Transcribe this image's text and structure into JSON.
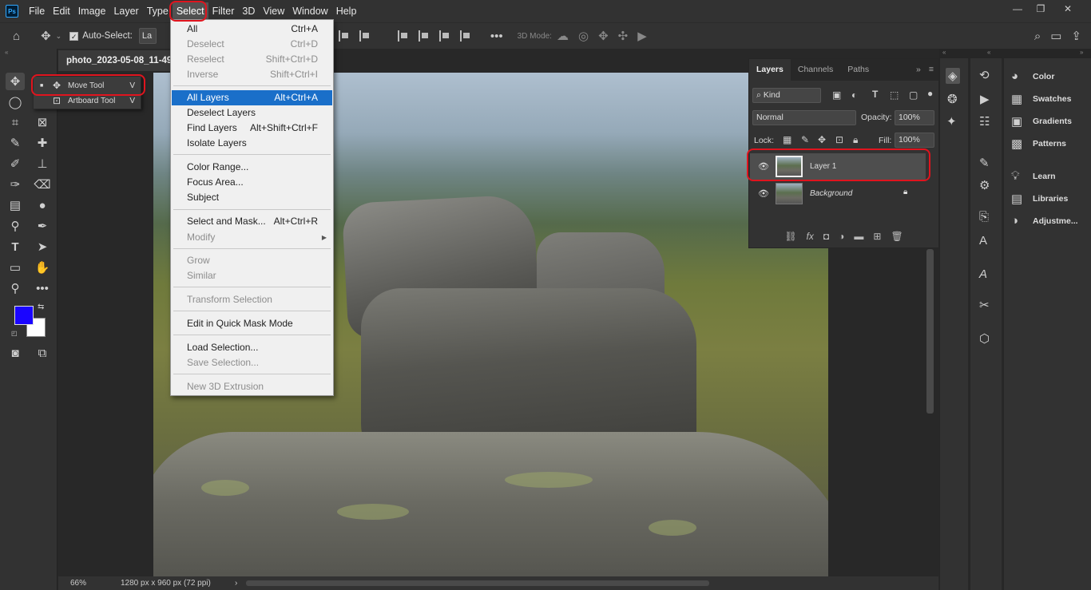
{
  "menubar": {
    "logo": "Ps",
    "items": [
      "File",
      "Edit",
      "Image",
      "Layer",
      "Type",
      "Select",
      "Filter",
      "3D",
      "View",
      "Window",
      "Help"
    ],
    "active_index": 5
  },
  "window_controls": {
    "minimize": "—",
    "restore": "❐",
    "close": "✕"
  },
  "options_bar": {
    "auto_select_label": "Auto-Select:",
    "auto_select_value": "La",
    "more": "•••",
    "mode_3d_label": "3D Mode:"
  },
  "document": {
    "tab_title": "photo_2023-05-08_11-49",
    "zoom": "66%",
    "dimensions": "1280 px x 960 px (72 ppi)"
  },
  "tool_flyout": {
    "items": [
      {
        "label": "Move Tool",
        "key": "V",
        "icon": "move-icon"
      },
      {
        "label": "Artboard Tool",
        "key": "V",
        "icon": "artboard-icon"
      }
    ]
  },
  "select_menu": {
    "items": [
      {
        "label": "All",
        "shortcut": "Ctrl+A",
        "disabled": false
      },
      {
        "label": "Deselect",
        "shortcut": "Ctrl+D",
        "disabled": true
      },
      {
        "label": "Reselect",
        "shortcut": "Shift+Ctrl+D",
        "disabled": true
      },
      {
        "label": "Inverse",
        "shortcut": "Shift+Ctrl+I",
        "disabled": true
      },
      {
        "label": "All Layers",
        "shortcut": "Alt+Ctrl+A",
        "highlighted": true
      },
      {
        "label": "Deselect Layers",
        "shortcut": ""
      },
      {
        "label": "Find Layers",
        "shortcut": "Alt+Shift+Ctrl+F"
      },
      {
        "label": "Isolate Layers",
        "shortcut": ""
      },
      {
        "label": "Color Range...",
        "shortcut": ""
      },
      {
        "label": "Focus Area...",
        "shortcut": ""
      },
      {
        "label": "Subject",
        "shortcut": ""
      },
      {
        "label": "Select and Mask...",
        "shortcut": "Alt+Ctrl+R"
      },
      {
        "label": "Modify",
        "shortcut": "",
        "submenu": true,
        "disabled": true
      },
      {
        "label": "Grow",
        "shortcut": "",
        "disabled": true
      },
      {
        "label": "Similar",
        "shortcut": "",
        "disabled": true
      },
      {
        "label": "Transform Selection",
        "shortcut": "",
        "disabled": true
      },
      {
        "label": "Edit in Quick Mask Mode",
        "shortcut": ""
      },
      {
        "label": "Load Selection...",
        "shortcut": ""
      },
      {
        "label": "Save Selection...",
        "shortcut": "",
        "disabled": true
      },
      {
        "label": "New 3D Extrusion",
        "shortcut": "",
        "disabled": true
      }
    ]
  },
  "layers_panel": {
    "tabs": [
      "Layers",
      "Channels",
      "Paths"
    ],
    "filter_kind": "Kind",
    "blend_mode": "Normal",
    "opacity_label": "Opacity:",
    "opacity_value": "100%",
    "lock_label": "Lock:",
    "fill_label": "Fill:",
    "fill_value": "100%",
    "layers": [
      {
        "name": "Layer 1",
        "selected": true,
        "locked": false
      },
      {
        "name": "Background",
        "selected": false,
        "locked": true
      }
    ]
  },
  "right_dock": {
    "items": [
      "Color",
      "Swatches",
      "Gradients",
      "Patterns",
      "Learn",
      "Libraries",
      "Adjustme..."
    ]
  },
  "colors": {
    "foreground": "#1a05ff",
    "background": "#ffffff",
    "highlight": "#1a6fc9",
    "annotation": "#e0141e"
  }
}
